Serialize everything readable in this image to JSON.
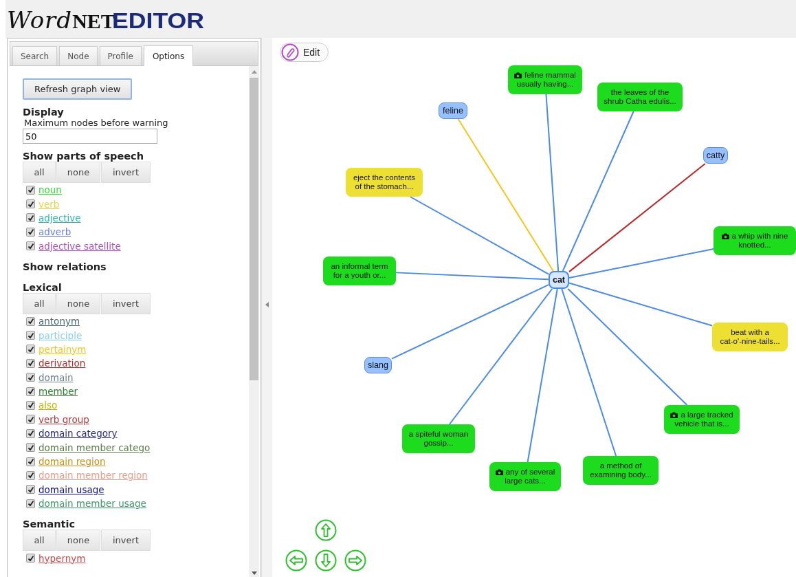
{
  "logo": {
    "part_1": "Word",
    "part_2": "NET",
    "part_3": "EDITOR"
  },
  "tabs": [
    {
      "label": "Search",
      "selected": false
    },
    {
      "label": "Node",
      "selected": false
    },
    {
      "label": "Profile",
      "selected": false
    },
    {
      "label": "Options",
      "selected": true
    }
  ],
  "options": {
    "refresh_button": "Refresh graph view",
    "display": {
      "heading": "Display",
      "label": "Maximum nodes before warning",
      "value": "50"
    },
    "parts_of_speech": {
      "heading": "Show parts of speech",
      "buttons": [
        "all",
        "none",
        "invert"
      ],
      "items": [
        {
          "label": "noun",
          "checked": true,
          "color": "#33dd33"
        },
        {
          "label": "verb",
          "checked": true,
          "color": "#e8d24a"
        },
        {
          "label": "adjective",
          "checked": true,
          "color": "#2fb8a8"
        },
        {
          "label": "adverb",
          "checked": true,
          "color": "#6a7fcf"
        },
        {
          "label": "adjective satellite",
          "checked": true,
          "color": "#b04fc4"
        }
      ]
    },
    "relations_heading": "Show relations",
    "lexical": {
      "heading": "Lexical",
      "buttons": [
        "all",
        "none",
        "invert"
      ],
      "items": [
        {
          "label": "antonym",
          "checked": true,
          "color": "#4a6a7a"
        },
        {
          "label": "participle",
          "checked": true,
          "color": "#87ceeb"
        },
        {
          "label": "pertainym",
          "checked": true,
          "color": "#f5c518"
        },
        {
          "label": "derivation",
          "checked": true,
          "color": "#c02828"
        },
        {
          "label": "domain",
          "checked": true,
          "color": "#708090"
        },
        {
          "label": "member",
          "checked": true,
          "color": "#2e7d32"
        },
        {
          "label": "also",
          "checked": true,
          "color": "#c8b400"
        },
        {
          "label": "verb group",
          "checked": true,
          "color": "#b03a3a"
        },
        {
          "label": "domain category",
          "checked": true,
          "color": "#2a2a8a"
        },
        {
          "label": "domain member catego",
          "checked": true,
          "color": "#5a7a4a"
        },
        {
          "label": "domain region",
          "checked": true,
          "color": "#c8901a"
        },
        {
          "label": "domain member region",
          "checked": true,
          "color": "#f09a8a"
        },
        {
          "label": "domain usage",
          "checked": true,
          "color": "#10108a"
        },
        {
          "label": "domain member usage",
          "checked": true,
          "color": "#3a9a6a"
        }
      ]
    },
    "semantic": {
      "heading": "Semantic",
      "buttons": [
        "all",
        "none",
        "invert"
      ],
      "items": [
        {
          "label": "hypernym",
          "checked": true,
          "color": "#d04848"
        }
      ]
    }
  },
  "graph": {
    "edit_button": "Edit",
    "center": {
      "text": "cat"
    },
    "nodes": [
      {
        "text": "feline mammal\nusually having...",
        "kind": "noun",
        "image": true,
        "color": "#4a8ae8"
      },
      {
        "text": "feline",
        "kind": "word",
        "image": false,
        "color": "#f5c518"
      },
      {
        "text": "the leaves of the\nshrub Catha edulis...",
        "kind": "noun",
        "image": false,
        "color": "#4a8ae8"
      },
      {
        "text": "catty",
        "kind": "word",
        "image": false,
        "color": "#b82828"
      },
      {
        "text": "eject the contents\nof the stomach...",
        "kind": "verb",
        "image": false,
        "color": "#4a8ae8"
      },
      {
        "text": "a whip with nine\nknotted...",
        "kind": "noun",
        "image": true,
        "color": "#4a8ae8"
      },
      {
        "text": "an informal term\nfor a youth or...",
        "kind": "noun",
        "image": false,
        "color": "#4a8ae8"
      },
      {
        "text": "beat with a\ncat-o'-nine-tails...",
        "kind": "verb",
        "image": false,
        "color": "#4a8ae8"
      },
      {
        "text": "slang",
        "kind": "word",
        "image": false,
        "color": "#4a8ae8"
      },
      {
        "text": "a spiteful woman\ngossip...",
        "kind": "noun",
        "image": false,
        "color": "#4a8ae8"
      },
      {
        "text": "a large tracked\nvehicle that is...",
        "kind": "noun",
        "image": true,
        "color": "#4a8ae8"
      },
      {
        "text": "any of several\nlarge cats...",
        "kind": "noun",
        "image": true,
        "color": "#4a8ae8"
      },
      {
        "text": "a method of\nexamining body...",
        "kind": "noun",
        "image": false,
        "color": "#4a8ae8"
      }
    ]
  }
}
